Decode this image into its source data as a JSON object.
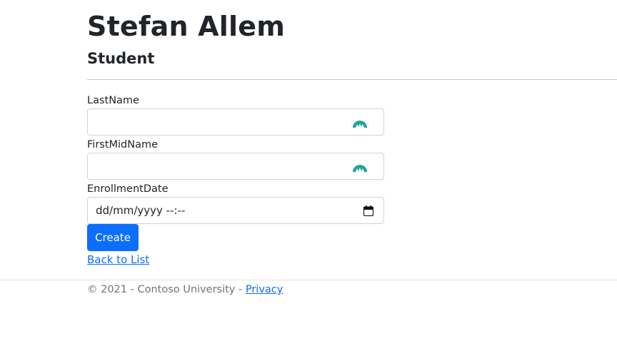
{
  "header": {
    "title": "Stefan Allem",
    "subtitle": "Student"
  },
  "form": {
    "last_name": {
      "label": "LastName",
      "value": ""
    },
    "first_mid_name": {
      "label": "FirstMidName",
      "value": ""
    },
    "enrollment_date": {
      "label": "EnrollmentDate",
      "placeholder": "dd/mm/yyyy --:--"
    },
    "create_label": "Create"
  },
  "back_link": "Back to List",
  "footer": {
    "text": "© 2021 - Contoso University - ",
    "privacy_label": "Privacy"
  },
  "colors": {
    "primary": "#0d6efd",
    "extension_icon": "#1fa39a"
  },
  "icons": {
    "field_extension": "password-manager-icon",
    "date_picker": "calendar-icon"
  }
}
